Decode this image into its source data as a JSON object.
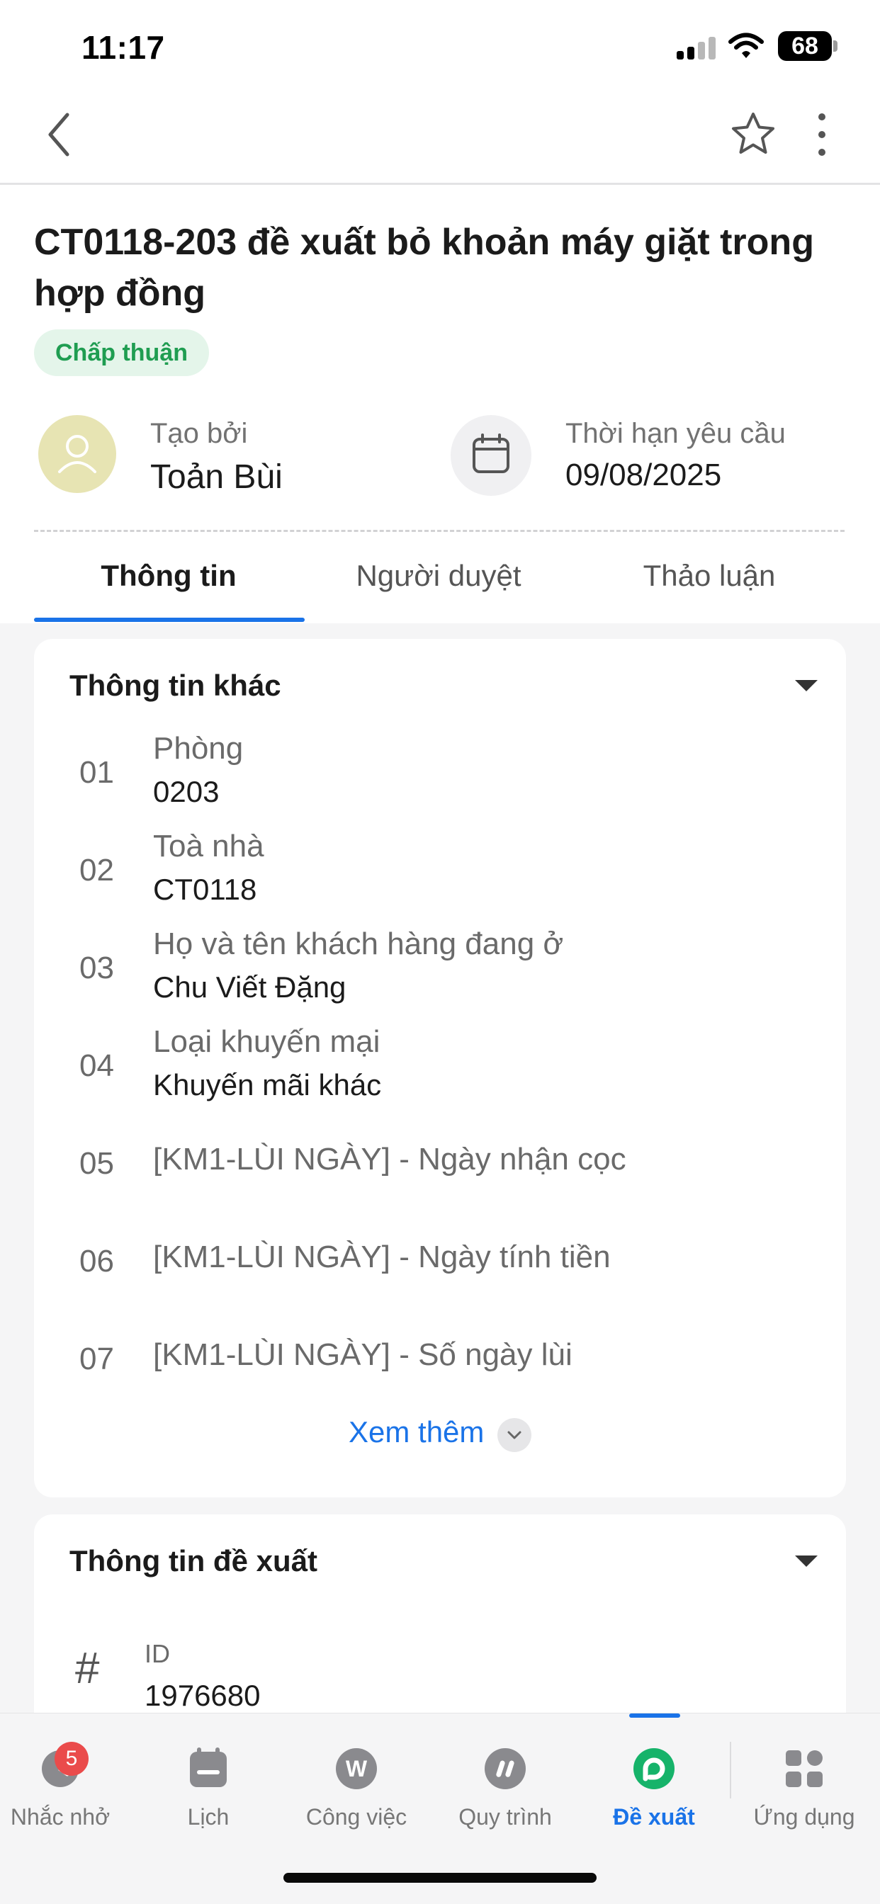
{
  "status_bar": {
    "time": "11:17",
    "battery": "68"
  },
  "header": {
    "back_icon": "chevron-left-icon",
    "favorite_icon": "star-outline-icon",
    "more_icon": "more-vertical-icon"
  },
  "request": {
    "title": "CT0118-203 đề xuất bỏ khoản máy giặt trong hợp đồng",
    "status": "Chấp thuận",
    "created_by_label": "Tạo bởi",
    "created_by": "Toản Bùi",
    "deadline_label": "Thời hạn yêu cầu",
    "deadline": "09/08/2025"
  },
  "tabs": [
    {
      "label": "Thông tin"
    },
    {
      "label": "Người duyệt"
    },
    {
      "label": "Thảo luận"
    }
  ],
  "other_info": {
    "title": "Thông tin khác",
    "fields": [
      {
        "num": "01",
        "label": "Phòng",
        "value": "0203"
      },
      {
        "num": "02",
        "label": "Toà nhà",
        "value": "CT0118"
      },
      {
        "num": "03",
        "label": "Họ và tên khách hàng đang ở",
        "value": "Chu Viết Đặng"
      },
      {
        "num": "04",
        "label": "Loại khuyến mại",
        "value": "Khuyến mãi khác"
      },
      {
        "num": "05",
        "label": "[KM1-LÙI NGÀY] - Ngày nhận cọc",
        "value": ""
      },
      {
        "num": "06",
        "label": "[KM1-LÙI NGÀY] - Ngày tính tiền",
        "value": ""
      },
      {
        "num": "07",
        "label": "[KM1-LÙI NGÀY] - Số ngày lùi",
        "value": ""
      }
    ],
    "see_more": "Xem thêm"
  },
  "proposal_info": {
    "title": "Thông tin đề xuất",
    "id_label": "ID",
    "id_value": "1976680",
    "id_icon": "#"
  },
  "bottom_nav": {
    "items": [
      {
        "label": "Nhắc nhở",
        "icon": "reminder-clock-icon",
        "badge": "5"
      },
      {
        "label": "Lịch",
        "icon": "calendar-icon"
      },
      {
        "label": "Công việc",
        "icon": "work-w-icon"
      },
      {
        "label": "Quy trình",
        "icon": "workflow-icon"
      },
      {
        "label": "Đề xuất",
        "icon": "proposal-icon",
        "active": true
      },
      {
        "label": "Ứng dụng",
        "icon": "apps-grid-icon"
      }
    ]
  },
  "colors": {
    "accent": "#1a73e8",
    "success": "#1f9d51",
    "badge_bg": "#e4f5ea",
    "proposal_green": "#16b36a",
    "notification": "#ea4b4b"
  }
}
